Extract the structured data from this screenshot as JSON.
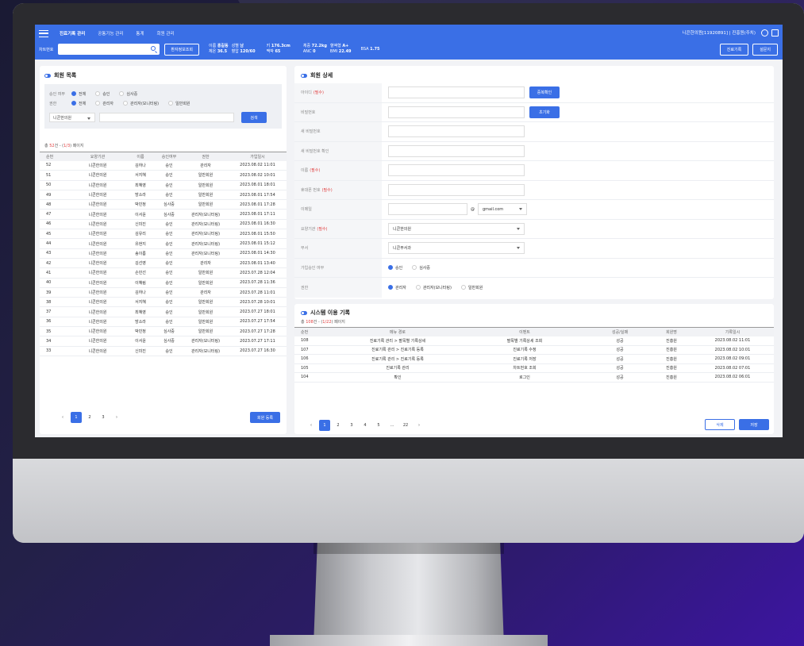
{
  "nav": {
    "items": [
      "진료기록 관리",
      "공통기능 관리",
      "통계",
      "회원 관리"
    ],
    "user": "니콘한의원[11920891] | 진흥원(주치)"
  },
  "patient": {
    "chart_label": "차트번호",
    "lookup_btn": "환자정보조회",
    "info": [
      {
        "k": "이름",
        "v": "홍길동"
      },
      {
        "k": "성별",
        "v": "남"
      },
      {
        "k": "체온",
        "v": "36.5"
      },
      {
        "k": "혈압",
        "v": "120/60"
      },
      {
        "k": "키",
        "v": "176.3cm"
      },
      {
        "k": "맥박",
        "v": "65"
      },
      {
        "k": "체중",
        "v": "72.2kg"
      },
      {
        "k": "ANC",
        "v": "0"
      },
      {
        "k": "혈액형",
        "v": "A+"
      },
      {
        "k": "BMI",
        "v": "22.49"
      },
      {
        "k": "BSA",
        "v": "1.75"
      }
    ],
    "buttons": [
      "진료기록",
      "설문지"
    ]
  },
  "members": {
    "title": "회원 목록",
    "filter": {
      "approval_label": "승인 여부",
      "approval_options": [
        "전체",
        "승인",
        "심사중"
      ],
      "role_label": "권한",
      "role_options": [
        "전체",
        "관리자",
        "관리자(모니터링)",
        "일반회원"
      ],
      "org_select": "니콘한의원",
      "search_btn": "검색"
    },
    "count": {
      "prefix": "총 ",
      "total": "52",
      "suffix": "건 - (",
      "page": "1/3",
      "end": ") 페이지"
    },
    "columns": [
      "순번",
      "요양기관",
      "이름",
      "승인여부",
      "권한",
      "가입일시"
    ],
    "rows": [
      [
        "52",
        "니콘한의원",
        "김하나",
        "승인",
        "관리자",
        "2023.08.02 11:01"
      ],
      [
        "51",
        "니콘한의원",
        "서지혜",
        "승인",
        "일반회원",
        "2023.08.02 10:01"
      ],
      [
        "50",
        "니콘한의원",
        "최혜영",
        "승인",
        "일반회원",
        "2023.08.01 18:01"
      ],
      [
        "49",
        "니콘한의원",
        "방소라",
        "승인",
        "일반회원",
        "2023.08.01 17:54"
      ],
      [
        "48",
        "니콘한의원",
        "박민정",
        "심사중",
        "일반회원",
        "2023.08.01 17:28"
      ],
      [
        "47",
        "니콘한의원",
        "이서윤",
        "심사중",
        "관리자(모니터링)",
        "2023.08.01 17:11"
      ],
      [
        "46",
        "니콘한의원",
        "신미진",
        "승인",
        "관리자(모니터링)",
        "2023.08.01 16:30"
      ],
      [
        "45",
        "니콘한의원",
        "김유리",
        "승인",
        "관리자(모니터링)",
        "2023.08.01 15:50"
      ],
      [
        "44",
        "니콘한의원",
        "유현지",
        "승인",
        "관리자(모니터링)",
        "2023.08.01 15:12"
      ],
      [
        "43",
        "니콘한의원",
        "송이름",
        "승인",
        "관리자(모니터링)",
        "2023.08.01 14:30"
      ],
      [
        "42",
        "니콘한의원",
        "김선영",
        "승인",
        "관리자",
        "2023.08.01 13:40"
      ],
      [
        "41",
        "니콘한의원",
        "손민선",
        "승인",
        "일반회원",
        "2023.07.28 12:04"
      ],
      [
        "40",
        "니콘한의원",
        "이혜림",
        "승인",
        "일반회원",
        "2023.07.28 11:36"
      ],
      [
        "39",
        "니콘한의원",
        "김하나",
        "승인",
        "관리자",
        "2023.07.28 11:01"
      ],
      [
        "38",
        "니콘한의원",
        "서지혜",
        "승인",
        "일반회원",
        "2023.07.28 10:01"
      ],
      [
        "37",
        "니콘한의원",
        "최혜영",
        "승인",
        "일반회원",
        "2023.07.27 18:01"
      ],
      [
        "36",
        "니콘한의원",
        "방소라",
        "승인",
        "일반회원",
        "2023.07.27 17:54"
      ],
      [
        "35",
        "니콘한의원",
        "박민정",
        "심사중",
        "일반회원",
        "2023.07.27 17:28"
      ],
      [
        "34",
        "니콘한의원",
        "이서윤",
        "심사중",
        "관리자(모니터링)",
        "2023.07.27 17:11"
      ],
      [
        "33",
        "니콘한의원",
        "신미진",
        "승인",
        "관리자(모니터링)",
        "2023.07.27 16:30"
      ]
    ],
    "pages": [
      "1",
      "2",
      "3"
    ],
    "register_btn": "회원 등록"
  },
  "detail": {
    "title": "회원 상세",
    "required": "(필수)",
    "labels": {
      "id": "아이디",
      "pw": "비밀번호",
      "newpw": "새 비밀번호",
      "newpw2": "새 비밀번호 확인",
      "name": "이름",
      "phone": "휴대폰 번호",
      "email": "이메일",
      "org": "요양기관",
      "dept": "부서",
      "approval": "가입승인 여부",
      "role": "권한"
    },
    "dup_btn": "중복확인",
    "reset_btn": "초기화",
    "email_at": "@",
    "email_domain": "gmail.com",
    "org_value": "니콘한의원",
    "dept_value": "니콘부서과",
    "approval_options": [
      "승인",
      "심사중"
    ],
    "role_options": [
      "관리자",
      "관리자(모니터링)",
      "일반회원"
    ]
  },
  "logs": {
    "title": "시스템 이용 기록",
    "count": {
      "prefix": "총 ",
      "total": "108",
      "suffix": "건 - (",
      "page": "1/22",
      "end": ") 페이지"
    },
    "columns": [
      "순번",
      "메뉴 경로",
      "이벤트",
      "성공/실패",
      "회원명",
      "기록일시"
    ],
    "rows": [
      [
        "108",
        "진료기록 관리 > 팔목별 기록상세",
        "팔목별 기록상세 조회",
        "성공",
        "진흥원",
        "2023.08.02 11:01"
      ],
      [
        "107",
        "진료기록 관리 > 진료기록 등록",
        "진료기록 수정",
        "성공",
        "진흥원",
        "2023.08.02 10:01"
      ],
      [
        "106",
        "진료기록 관리 > 진료기록 등록",
        "진료기록 저장",
        "성공",
        "진흥원",
        "2023.08.02 09:01"
      ],
      [
        "105",
        "진료기록 관리",
        "차트번호 조회",
        "성공",
        "진흥원",
        "2023.08.02 07:01"
      ],
      [
        "104",
        "확인",
        "로그인",
        "성공",
        "진흥원",
        "2023.08.02 06:01"
      ]
    ],
    "pages": [
      "1",
      "2",
      "3",
      "4",
      "5",
      "...",
      "22"
    ],
    "delete_btn": "삭제",
    "save_btn": "저장"
  },
  "colors": {
    "accent": "#3a6fe6",
    "required": "#e04040"
  }
}
